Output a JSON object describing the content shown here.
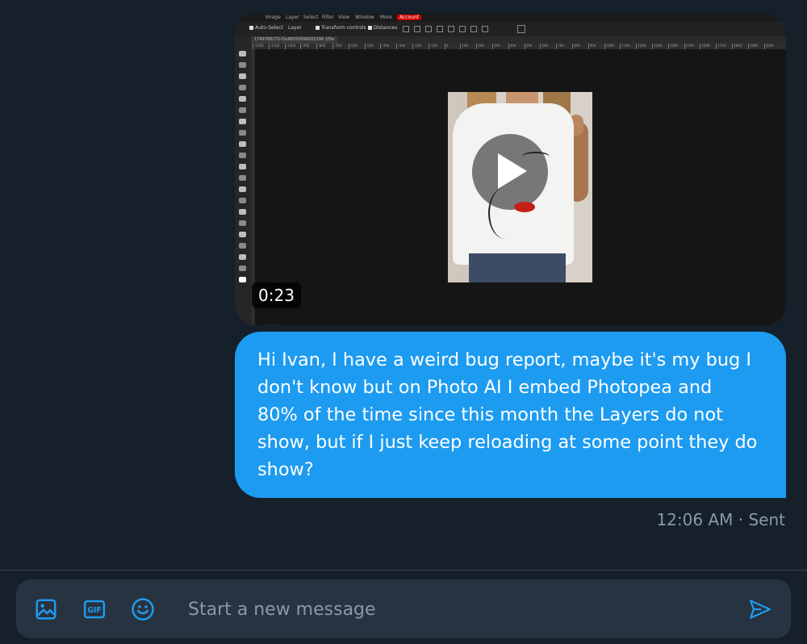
{
  "media": {
    "duration": "0:23",
    "photopea_menu": [
      "Image",
      "Layer",
      "Select",
      "Filter",
      "View",
      "Window",
      "More",
      "Account"
    ],
    "photopea_toolbar": {
      "auto_select": "Auto-Select",
      "layer_select": "Layer",
      "transform_controls": "Transform controls",
      "distances": "Distances"
    },
    "document_tab": "1749766270-f1e86550999202396 1f5e",
    "ruler_labels": [
      "-1200",
      "-1100",
      "-1000",
      "-900",
      "-800",
      "-700",
      "-600",
      "-500",
      "-400",
      "-300",
      "-200",
      "-100",
      "0",
      "100",
      "200",
      "300",
      "400",
      "500",
      "600",
      "700",
      "800",
      "900",
      "1000",
      "1100",
      "1200",
      "1300",
      "1400",
      "1500",
      "1600",
      "1700",
      "1800",
      "1900",
      "2000"
    ]
  },
  "message": {
    "text": "Hi Ivan, I have a weird bug report, maybe it's my bug I don't know but on Photo AI I embed Photopea and 80% of the time since this month the Layers do not show, but if I just keep reloading at some point they do show?",
    "lines": [
      "Hi Ivan, I have a weird bug report, maybe it's my bug I",
      "don't know but on Photo AI I embed Photopea and",
      "80% of the time since this month the Layers do not",
      "show, but if I just keep reloading at some point they do",
      "show?"
    ],
    "timestamp": "12:06 AM",
    "separator": "·",
    "status": "Sent"
  },
  "composer": {
    "placeholder": "Start a new message",
    "icons": [
      "image-icon",
      "gif-icon",
      "emoji-icon",
      "send-icon"
    ]
  },
  "colors": {
    "background": "#15202b",
    "bubble": "#1d9bf0",
    "composer": "#273340",
    "accent": "#1d9bf0",
    "muted_text": "#8b98a5"
  }
}
